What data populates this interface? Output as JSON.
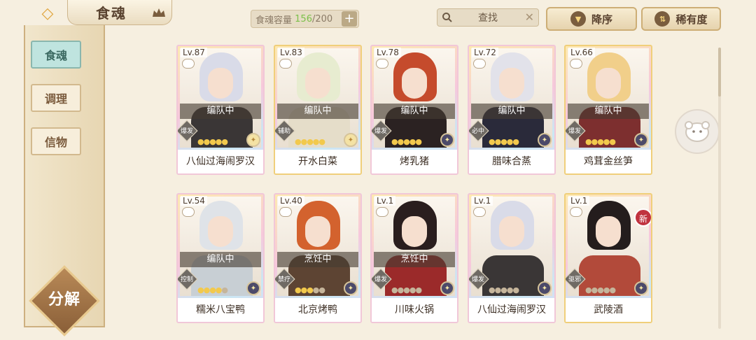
{
  "header": {
    "title": "食魂",
    "capacity_label": "食魂容量",
    "capacity_current": "156",
    "capacity_max": "/200",
    "add_symbol": "+",
    "search_text": "查找",
    "sort_desc_label": "降序",
    "sort_rarity_label": "稀有度"
  },
  "sidebar": {
    "items": [
      {
        "label": "食魂"
      },
      {
        "label": "调理"
      },
      {
        "label": "信物"
      }
    ],
    "decompose_label": "分解"
  },
  "cards": [
    {
      "level": "Lv.87",
      "name": "八仙过海闹罗汉",
      "status": "编队中",
      "role": "爆发",
      "stars_filled": 5,
      "hair": "#d9dbe8",
      "outfit": "#3a3636"
    },
    {
      "level": "Lv.83",
      "name": "开水白菜",
      "status": "编队中",
      "role": "辅助",
      "stars_filled": 5,
      "hair": "#e7ecd0",
      "outfit": "#e5ddc9"
    },
    {
      "level": "Lv.78",
      "name": "烤乳猪",
      "status": "编队中",
      "role": "爆发",
      "stars_filled": 5,
      "hair": "#c54b2c",
      "outfit": "#2b2222"
    },
    {
      "level": "Lv.72",
      "name": "腊味合蒸",
      "status": "编队中",
      "role": "必中",
      "stars_filled": 5,
      "hair": "#e2e2ea",
      "outfit": "#2a2a3a"
    },
    {
      "level": "Lv.66",
      "name": "鸡茸金丝笋",
      "status": "编队中",
      "role": "爆发",
      "stars_filled": 5,
      "hair": "#f1cf8a",
      "outfit": "#7d2f2f"
    },
    {
      "level": "Lv.54",
      "name": "糯米八宝鸭",
      "status": "编队中",
      "role": "控制",
      "stars_filled": 4,
      "hair": "#dfe3e8",
      "outfit": "#c8cfd4"
    },
    {
      "level": "Lv.40",
      "name": "北京烤鸭",
      "status": "烹饪中",
      "role": "禁疗",
      "stars_filled": 3,
      "hair": "#d3622e",
      "outfit": "#5d4433"
    },
    {
      "level": "Lv.1",
      "name": "川味火锅",
      "status": "烹饪中",
      "role": "爆发",
      "stars_filled": 0,
      "hair": "#2a1e1e",
      "outfit": "#9b2a2a"
    },
    {
      "level": "Lv.1",
      "name": "八仙过海闹罗汉",
      "status": "",
      "role": "爆发",
      "stars_filled": 0,
      "hair": "#d9dbe8",
      "outfit": "#3a3636"
    },
    {
      "level": "Lv.1",
      "name": "武陵酒",
      "status": "",
      "role": "驱邪",
      "stars_filled": 0,
      "hair": "#241d1d",
      "outfit": "#b24a3a",
      "badge": "新"
    }
  ]
}
